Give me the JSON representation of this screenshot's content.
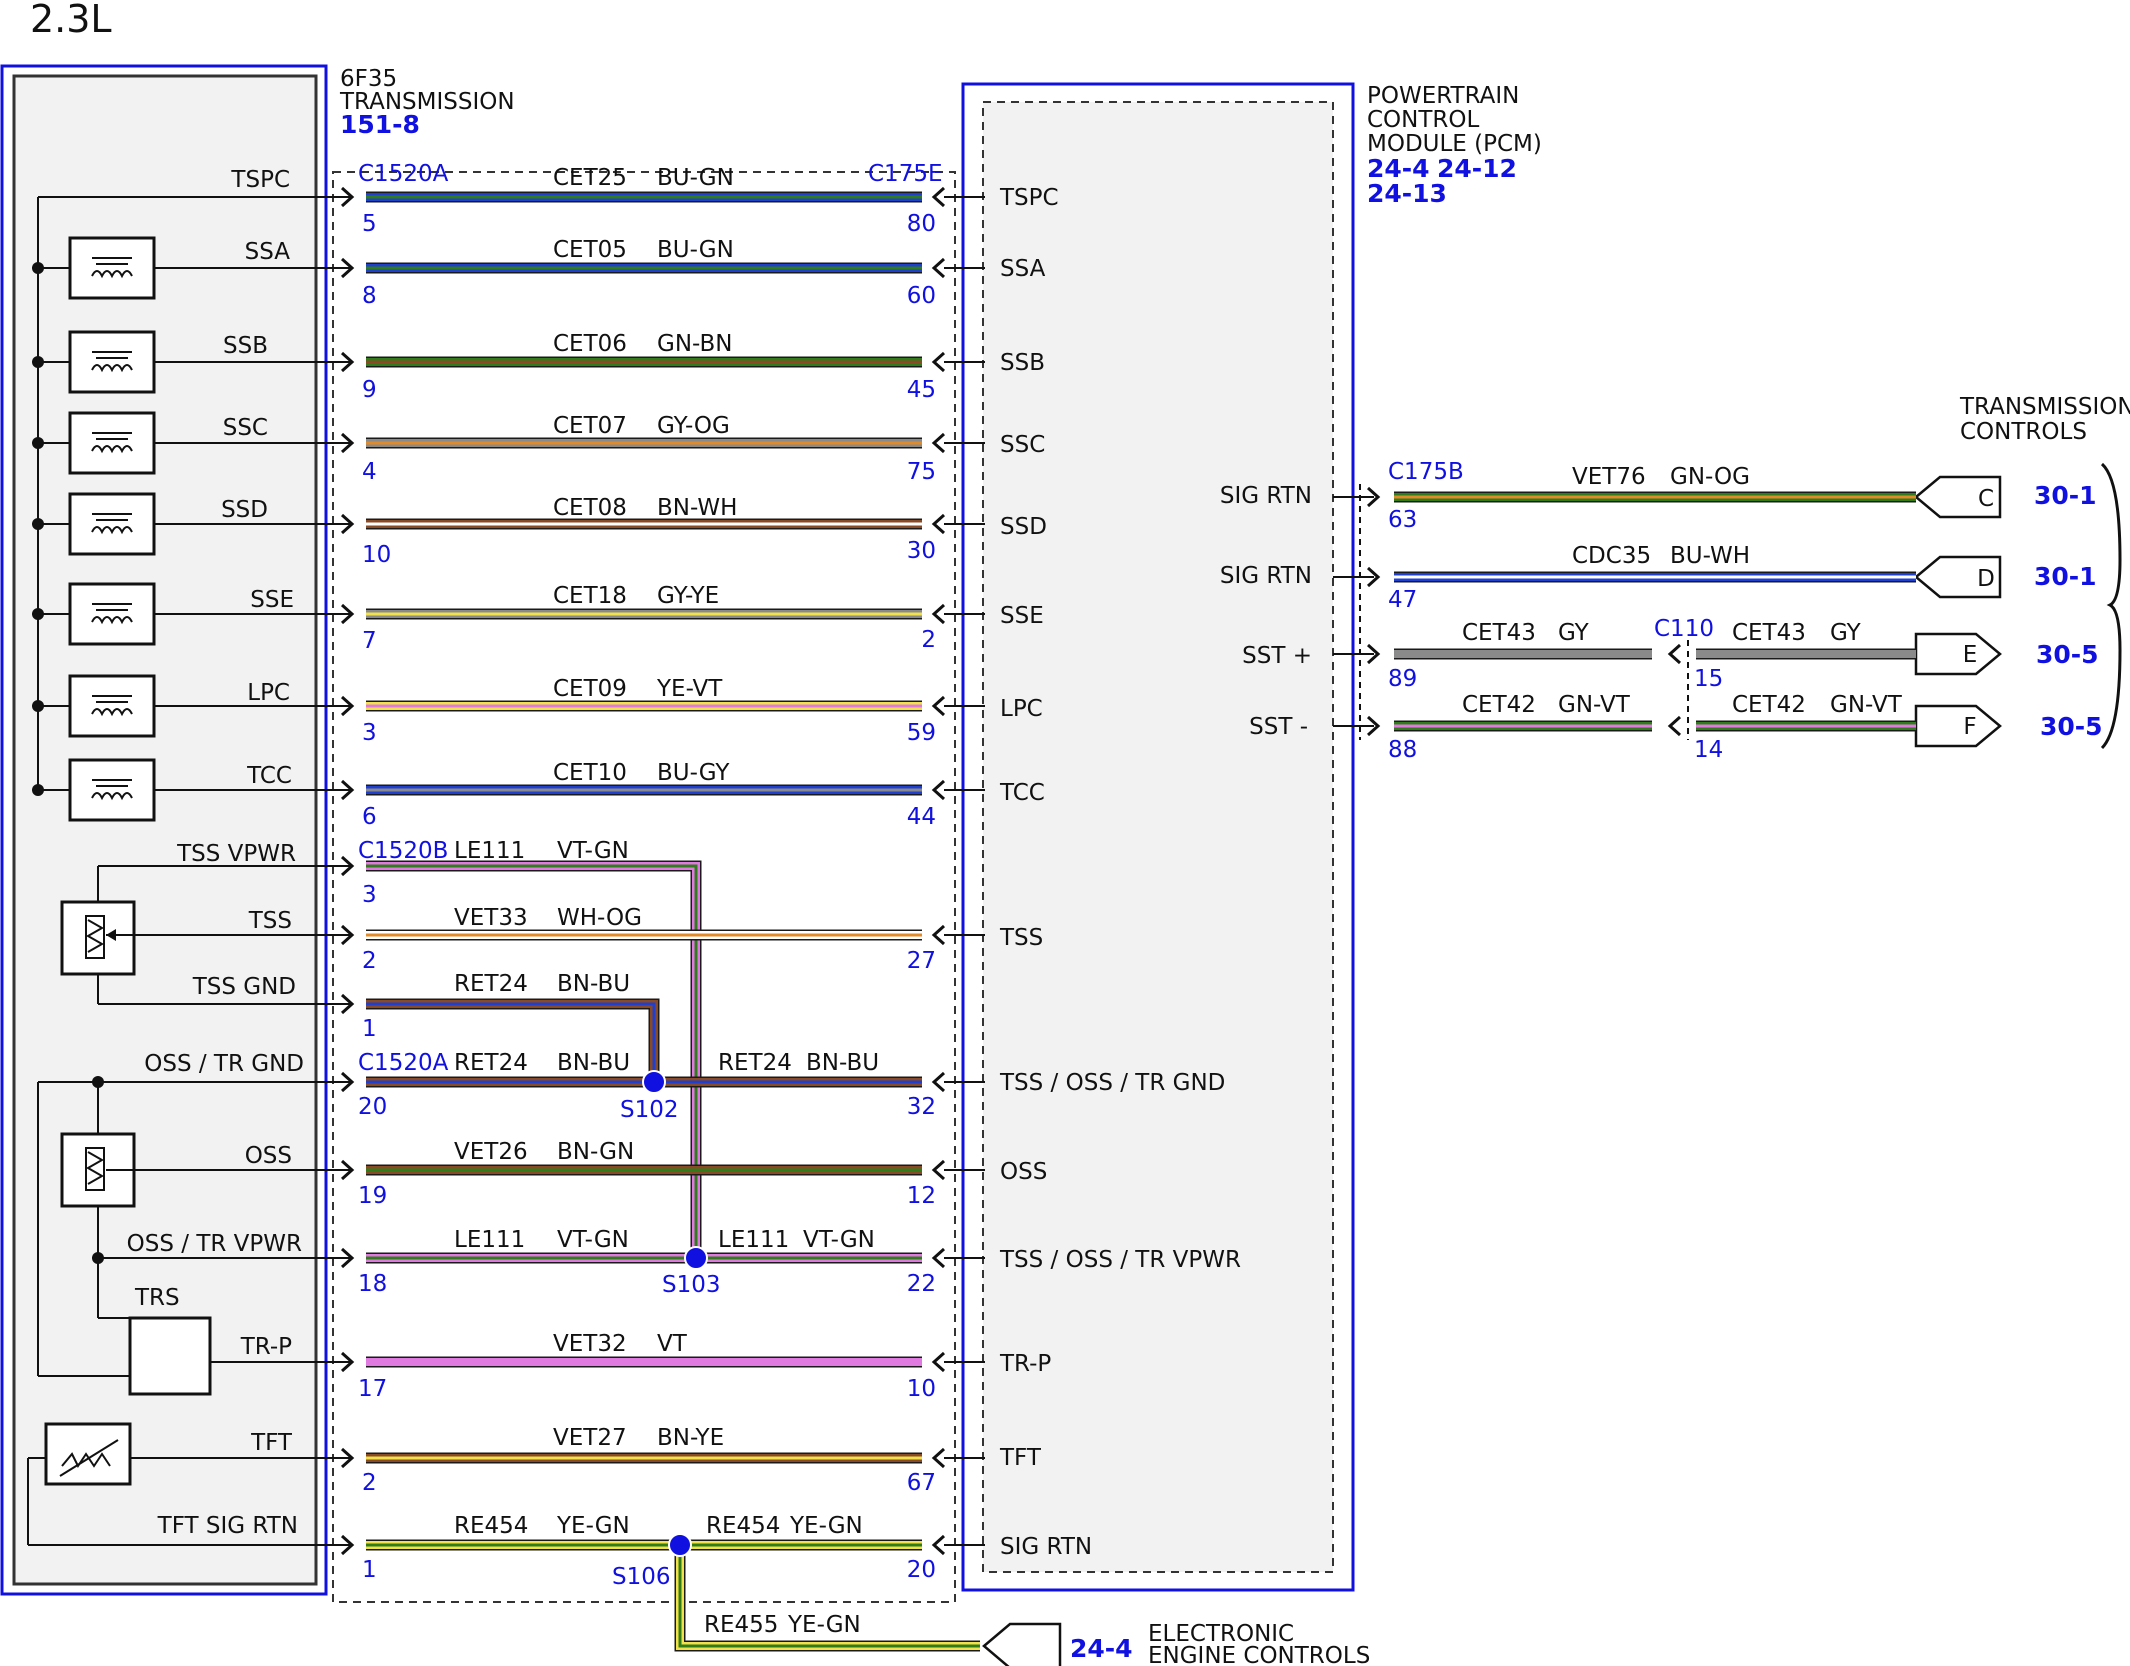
{
  "engine_label": "2.3L",
  "colors": {
    "accent_blue": "#1010e0",
    "box_fill": "#f2f2f2",
    "BU": "#1f3fd0",
    "GN": "#2f7d1a",
    "GY": "#8a8a8a",
    "OG": "#e08a2a",
    "BN": "#8a4a25",
    "WH": "#ffffff",
    "YE": "#f2e14a",
    "VT": "#e07ae0",
    "RD": "#c0202a"
  },
  "transmission": {
    "name_line1": "6F35",
    "name_line2": "TRANSMISSION",
    "ref": "151-8",
    "connectors": [
      "C1520A",
      "C1520B",
      "C1520A"
    ]
  },
  "pcm": {
    "name_line1": "POWERTRAIN",
    "name_line2": "CONTROL",
    "name_line3": "MODULE (PCM)",
    "refs": [
      "24-4",
      "24-12",
      "24-13"
    ],
    "connector_main": "C175E",
    "connector_right": "C175B"
  },
  "circuits": [
    {
      "left_label": "TSPC",
      "circuit": "CET25",
      "color_code": "BU-GN",
      "left_pin": "5",
      "right_pin": "80",
      "pcm_label": "TSPC",
      "stripes": [
        "BU",
        "GN"
      ]
    },
    {
      "left_label": "SSA",
      "circuit": "CET05",
      "color_code": "BU-GN",
      "left_pin": "8",
      "right_pin": "60",
      "pcm_label": "SSA",
      "stripes": [
        "BU",
        "GN"
      ]
    },
    {
      "left_label": "SSB",
      "circuit": "CET06",
      "color_code": "GN-BN",
      "left_pin": "9",
      "right_pin": "45",
      "pcm_label": "SSB",
      "stripes": [
        "GN",
        "BN"
      ]
    },
    {
      "left_label": "SSC",
      "circuit": "CET07",
      "color_code": "GY-OG",
      "left_pin": "4",
      "right_pin": "75",
      "pcm_label": "SSC",
      "stripes": [
        "GY",
        "OG"
      ]
    },
    {
      "left_label": "SSD",
      "circuit": "CET08",
      "color_code": "BN-WH",
      "left_pin": "10",
      "right_pin": "30",
      "pcm_label": "SSD",
      "stripes": [
        "BN",
        "WH"
      ]
    },
    {
      "left_label": "SSE",
      "circuit": "CET18",
      "color_code": "GY-YE",
      "left_pin": "7",
      "right_pin": "2",
      "pcm_label": "SSE",
      "stripes": [
        "GY",
        "YE"
      ]
    },
    {
      "left_label": "LPC",
      "circuit": "CET09",
      "color_code": "YE-VT",
      "left_pin": "3",
      "right_pin": "59",
      "pcm_label": "LPC",
      "stripes": [
        "YE",
        "VT"
      ]
    },
    {
      "left_label": "TCC",
      "circuit": "CET10",
      "color_code": "BU-GY",
      "left_pin": "6",
      "right_pin": "44",
      "pcm_label": "TCC",
      "stripes": [
        "BU",
        "GY"
      ]
    }
  ],
  "sensors": {
    "tss_vpwr": {
      "label": "TSS VPWR",
      "circuit": "LE111",
      "color_code": "VT-GN",
      "pin": "3"
    },
    "tss": {
      "label": "TSS",
      "circuit": "VET33",
      "color_code": "WH-OG",
      "left_pin": "2",
      "right_pin": "27",
      "pcm_label": "TSS"
    },
    "tss_gnd": {
      "label": "TSS GND",
      "circuit": "RET24",
      "color_code": "BN-BU",
      "pin": "1"
    },
    "oss_trgnd": {
      "label": "OSS / TR GND",
      "circuit": "RET24",
      "color_code": "BN-BU",
      "left_pin": "20",
      "right_pin": "32",
      "pcm_label": "TSS / OSS / TR GND",
      "right_circuit": "RET24",
      "right_color": "BN-BU",
      "splice": "S102"
    },
    "oss": {
      "label": "OSS",
      "circuit": "VET26",
      "color_code": "BN-GN",
      "left_pin": "19",
      "right_pin": "12",
      "pcm_label": "OSS"
    },
    "oss_trvpwr": {
      "label": "OSS / TR VPWR",
      "circuit": "LE111",
      "color_code": "VT-GN",
      "left_pin": "18",
      "right_pin": "22",
      "pcm_label": "TSS / OSS / TR VPWR",
      "right_circuit": "LE111",
      "right_color": "VT-GN",
      "splice": "S103"
    },
    "trs": {
      "label": "TRS"
    },
    "trp": {
      "label": "TR-P",
      "circuit": "VET32",
      "color_code": "VT",
      "left_pin": "17",
      "right_pin": "10",
      "pcm_label": "TR-P"
    },
    "tft": {
      "label": "TFT",
      "circuit": "VET27",
      "color_code": "BN-YE",
      "left_pin": "2",
      "right_pin": "67",
      "pcm_label": "TFT"
    },
    "tft_sig_rtn": {
      "label": "TFT SIG RTN",
      "circuit": "RE454",
      "color_code": "YE-GN",
      "left_pin": "1",
      "right_pin": "20",
      "pcm_label": "SIG RTN",
      "right_circuit": "RE454",
      "right_color": "YE-GN",
      "splice": "S106"
    }
  },
  "engine_controls": {
    "circuit": "RE455",
    "color_code": "YE-GN",
    "ref": "24-4",
    "label_line1": "ELECTRONIC",
    "label_line2": "ENGINE CONTROLS"
  },
  "trans_controls": {
    "label_line1": "TRANSMISSION",
    "label_line2": "CONTROLS",
    "inline_connector": "C110",
    "rows": [
      {
        "pcm_label": "SIG RTN",
        "pin": "63",
        "circuit": "VET76",
        "color_code": "GN-OG",
        "letter": "C",
        "ref": "30-1"
      },
      {
        "pcm_label": "SIG RTN",
        "pin": "47",
        "circuit": "CDC35",
        "color_code": "BU-WH",
        "letter": "D",
        "ref": "30-1"
      },
      {
        "pcm_label": "SST +",
        "pin": "89",
        "circuit": "CET43",
        "color_code": "GY",
        "c110_pin": "15",
        "circuit_b": "CET43",
        "color_code_b": "GY",
        "letter": "E",
        "ref": "30-5"
      },
      {
        "pcm_label": "SST -",
        "pin": "88",
        "circuit": "CET42",
        "color_code": "GN-VT",
        "c110_pin": "14",
        "circuit_b": "CET42",
        "color_code_b": "GN-VT",
        "letter": "F",
        "ref": "30-5"
      }
    ]
  }
}
